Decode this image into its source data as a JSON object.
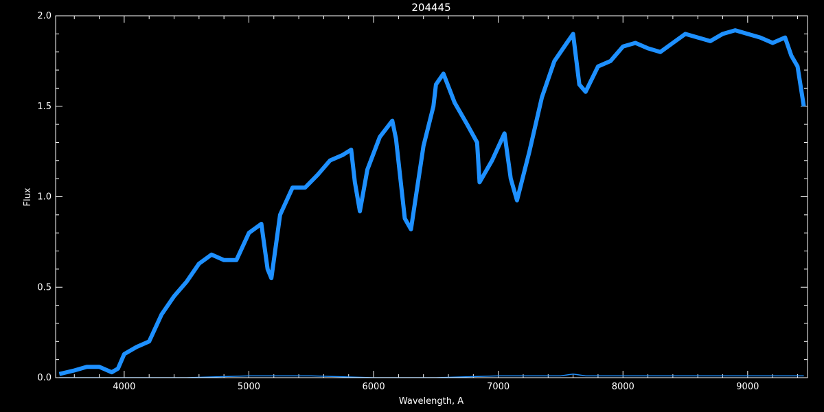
{
  "chart_data": {
    "type": "line",
    "title": "204445",
    "xlabel": "Wavelength, A",
    "ylabel": "Flux",
    "xlim": [
      3450,
      9480
    ],
    "ylim": [
      0,
      2.0
    ],
    "x_ticks": [
      4000,
      5000,
      6000,
      7000,
      8000,
      9000
    ],
    "x_tick_labels": [
      "4000",
      "5000",
      "6000",
      "7000",
      "8000",
      "9000"
    ],
    "y_ticks": [
      0.0,
      0.5,
      1.0,
      1.5,
      2.0
    ],
    "y_tick_labels": [
      "0.0",
      "0.5",
      "1.0",
      "1.5",
      "2.0"
    ],
    "grid": false,
    "colors": {
      "background": "#000000",
      "axes": "#ffffff",
      "spectrum": "#1e90ff",
      "secondary_trace": "#ffffff"
    },
    "series": [
      {
        "x": [
          3480,
          3600,
          3700,
          3800,
          3900,
          3950,
          4000,
          4100,
          4200,
          4300,
          4400,
          4500,
          4600,
          4700,
          4800,
          4900,
          5000,
          5100,
          5150,
          5180,
          5250,
          5350,
          5450,
          5550,
          5650,
          5750,
          5820,
          5850,
          5890,
          5950,
          6050,
          6150,
          6180,
          6250,
          6300,
          6400,
          6480,
          6500,
          6560,
          6650,
          6750,
          6830,
          6850,
          6950,
          7050,
          7100,
          7150,
          7250,
          7350,
          7450,
          7550,
          7600,
          7650,
          7700,
          7800,
          7900,
          8000,
          8100,
          8200,
          8300,
          8400,
          8500,
          8600,
          8700,
          8800,
          8900,
          9000,
          9100,
          9200,
          9300,
          9350,
          9400,
          9450
        ],
        "y": [
          0.02,
          0.04,
          0.06,
          0.06,
          0.03,
          0.05,
          0.13,
          0.17,
          0.2,
          0.35,
          0.45,
          0.53,
          0.63,
          0.68,
          0.65,
          0.65,
          0.8,
          0.85,
          0.6,
          0.55,
          0.9,
          1.05,
          1.05,
          1.12,
          1.2,
          1.23,
          1.26,
          1.08,
          0.92,
          1.15,
          1.33,
          1.42,
          1.32,
          0.88,
          0.82,
          1.28,
          1.5,
          1.62,
          1.68,
          1.52,
          1.4,
          1.3,
          1.08,
          1.2,
          1.35,
          1.1,
          0.98,
          1.25,
          1.55,
          1.75,
          1.85,
          1.9,
          1.62,
          1.58,
          1.72,
          1.75,
          1.83,
          1.85,
          1.82,
          1.8,
          1.85,
          1.9,
          1.88,
          1.86,
          1.9,
          1.92,
          1.9,
          1.88,
          1.85,
          1.88,
          1.78,
          1.72,
          1.5
        ]
      },
      {
        "x": [
          3480,
          4500,
          5000,
          5500,
          6000,
          6500,
          7000,
          7500,
          7600,
          7700,
          8000,
          8500,
          9000,
          9450
        ],
        "y": [
          0.0,
          0.0,
          0.01,
          0.01,
          0.0,
          0.0,
          0.01,
          0.01,
          0.02,
          0.01,
          0.01,
          0.01,
          0.01,
          0.01
        ]
      }
    ]
  }
}
